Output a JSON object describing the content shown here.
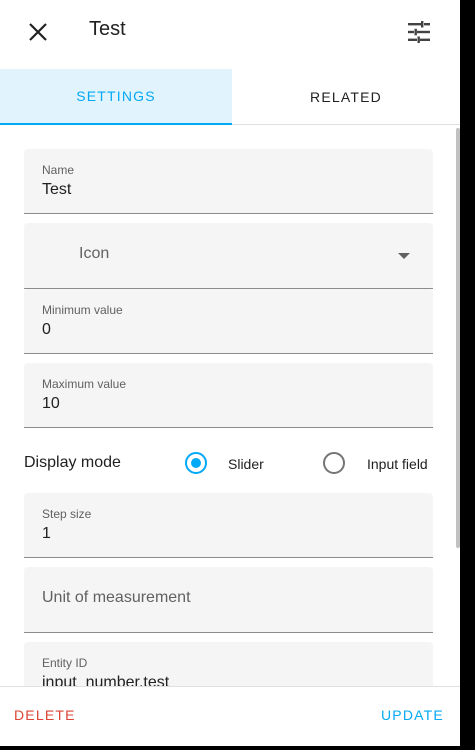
{
  "header": {
    "title": "Test"
  },
  "tabs": [
    {
      "label": "SETTINGS",
      "active": true
    },
    {
      "label": "RELATED",
      "active": false
    }
  ],
  "form": {
    "name": {
      "label": "Name",
      "value": "Test"
    },
    "icon": {
      "placeholder": "Icon"
    },
    "min": {
      "label": "Minimum value",
      "value": "0"
    },
    "max": {
      "label": "Maximum value",
      "value": "10"
    },
    "display_mode": {
      "label": "Display mode",
      "options": [
        {
          "label": "Slider",
          "checked": true
        },
        {
          "label": "Input field",
          "checked": false
        }
      ]
    },
    "step": {
      "label": "Step size",
      "value": "1"
    },
    "unit": {
      "placeholder": "Unit of measurement"
    },
    "entity_id": {
      "label": "Entity ID",
      "value": "input_number.test"
    }
  },
  "footer": {
    "delete_label": "DELETE",
    "update_label": "UPDATE"
  },
  "colors": {
    "accent": "#03a9f4",
    "danger": "#db4437",
    "tab_active_bg": "#e1f3fd"
  }
}
